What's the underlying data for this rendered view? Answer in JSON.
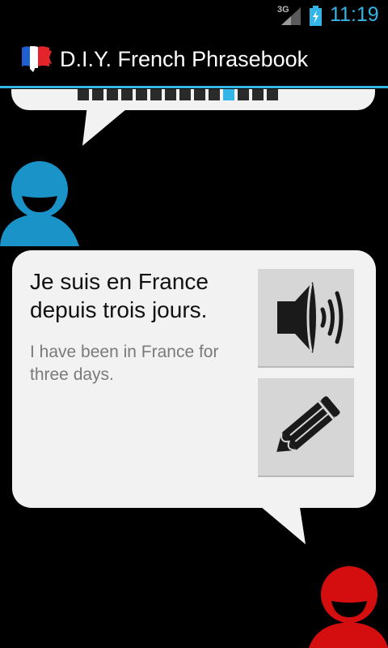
{
  "status_bar": {
    "network": "3G",
    "time": "11:19",
    "accent": "#33b5e5"
  },
  "action_bar": {
    "title": "D.I.Y. French Phrasebook",
    "icon": "french-flag-icon"
  },
  "progress": {
    "total": 14,
    "current": 11
  },
  "phrase": {
    "french": "Je suis en France depuis trois jours.",
    "english": "I have been in France for three days."
  },
  "buttons": {
    "play": "speaker-icon",
    "edit": "pencil-icon"
  },
  "speakers": {
    "top": {
      "color": "#1a93c8"
    },
    "bottom": {
      "color": "#d40e0e"
    }
  }
}
